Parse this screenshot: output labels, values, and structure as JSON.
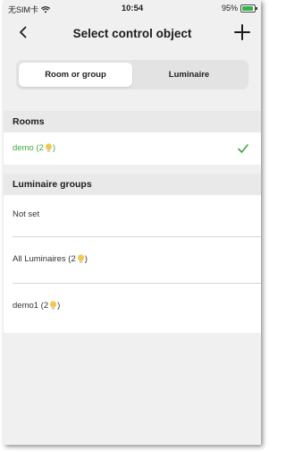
{
  "status_bar": {
    "carrier": "无SIM卡",
    "time": "10:54",
    "battery": "95%",
    "battery_level": 0.95
  },
  "nav": {
    "title": "Select control object",
    "back_icon": "chevron-left-icon",
    "add_icon": "plus-icon"
  },
  "segments": {
    "options": [
      "Room or group",
      "Luminaire"
    ],
    "selected": "Room or group"
  },
  "rooms": {
    "header": "Rooms",
    "items": [
      {
        "name": "demo (2",
        "suffix": ")",
        "selected": true
      }
    ]
  },
  "luminaire_groups": {
    "header": "Luminaire groups",
    "items": [
      {
        "name": "Not set",
        "suffix": ""
      },
      {
        "name": "All Luminaires (2",
        "suffix": ")"
      },
      {
        "name": "demo1 (2",
        "suffix": ")"
      }
    ]
  },
  "colors": {
    "accent": "#3fa63f",
    "background": "#f0f0f0",
    "header_bg": "#e9e9e9",
    "bulb": "#f2c94c"
  }
}
